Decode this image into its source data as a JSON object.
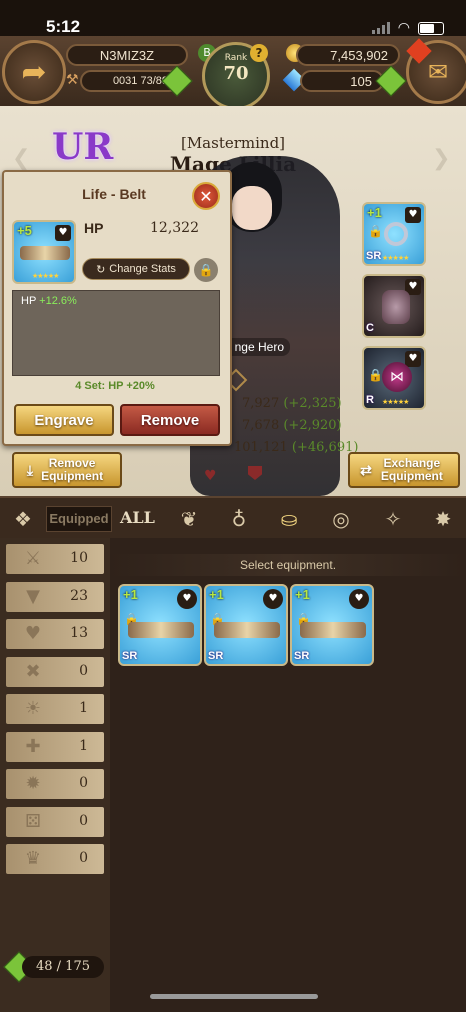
{
  "status_bar": {
    "time": "5:12"
  },
  "top_bar": {
    "player_name": "N3MIZ3Z",
    "stamina": "0031 73/89",
    "rank_label": "Rank",
    "rank_value": "70",
    "gold": "7,453,902",
    "gems": "105"
  },
  "hero": {
    "grade": "UR",
    "title": "[Mastermind]",
    "name": "Mage Lillia",
    "change_hero_label": "nge Hero",
    "stats": [
      {
        "value": "7,927",
        "delta": "(+2,325)"
      },
      {
        "value": "7,678",
        "delta": "(+2,920)"
      },
      {
        "value": "101,121",
        "delta": "(+46,691)"
      }
    ]
  },
  "popup": {
    "title": "Life - Belt",
    "stat_label": "HP",
    "stat_value": "12,322",
    "plus_level": "+5",
    "change_stats_label": "Change Stats",
    "substat_label": "HP",
    "substat_value": "+12.6%",
    "set_bonus": "4 Set: HP +20%",
    "engrave_label": "Engrave",
    "remove_label": "Remove"
  },
  "buttons": {
    "remove_equipment": "Remove Equipment",
    "exchange_equipment": "Exchange Equipment"
  },
  "tabs": {
    "equipped_label": "Equipped",
    "all_label": "ALL"
  },
  "filters": [
    {
      "icon": "sword-icon",
      "count": "10"
    },
    {
      "icon": "shield-icon",
      "count": "23"
    },
    {
      "icon": "heart-icon",
      "count": "13"
    },
    {
      "icon": "crit-icon",
      "count": "0"
    },
    {
      "icon": "sun-icon",
      "count": "1"
    },
    {
      "icon": "cross-icon",
      "count": "1"
    },
    {
      "icon": "burst-icon",
      "count": "0"
    },
    {
      "icon": "dice-icon",
      "count": "0"
    },
    {
      "icon": "crown-icon",
      "count": "0"
    }
  ],
  "grid": {
    "hint": "Select equipment.",
    "items": [
      {
        "plus": "+1",
        "grade": "SR"
      },
      {
        "plus": "+1",
        "grade": "SR"
      },
      {
        "plus": "+1",
        "grade": "SR"
      }
    ]
  },
  "inventory": {
    "count": "48 / 175"
  },
  "slots_right": [
    {
      "plus": "+1",
      "grade": "SR"
    },
    {
      "plus": "",
      "grade": "C"
    },
    {
      "plus": "",
      "grade": "R"
    }
  ],
  "colors": {
    "accent_gold": "#d9a93a",
    "gain_green": "#5a8a2a",
    "remove_red": "#a8392c"
  }
}
